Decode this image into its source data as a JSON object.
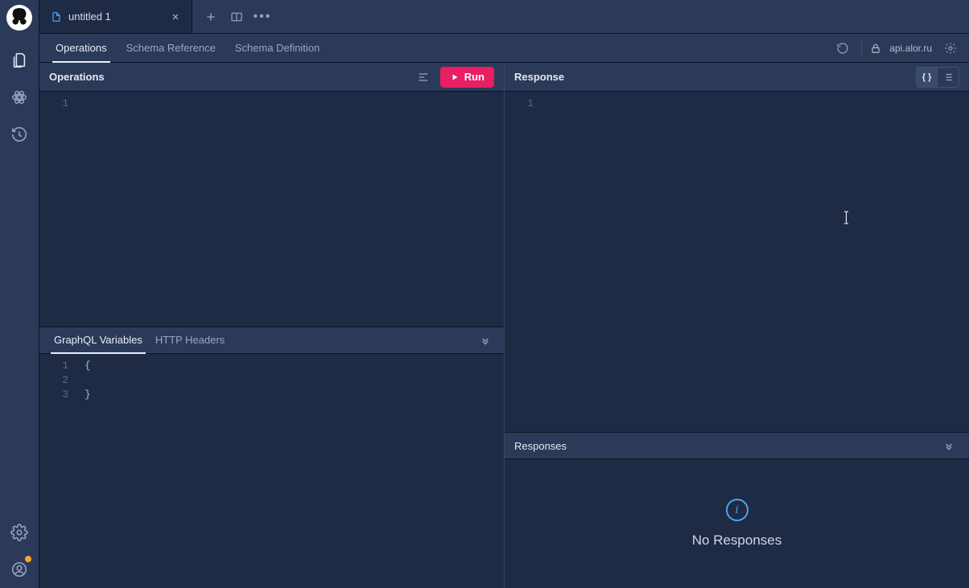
{
  "tab": {
    "label": "untitled 1"
  },
  "subTabs": {
    "operations": "Operations",
    "schemaRef": "Schema Reference",
    "schemaDef": "Schema Definition"
  },
  "endpoint": "api.alor.ru",
  "operations": {
    "title": "Operations",
    "run": "Run",
    "lines": [
      "1"
    ]
  },
  "response": {
    "title": "Response",
    "lines": [
      "1"
    ]
  },
  "variablesPanel": {
    "tabVariables": "GraphQL Variables",
    "tabHeaders": "HTTP Headers",
    "lineNumbers": [
      "1",
      "2",
      "3"
    ],
    "code": [
      "{",
      "",
      "}"
    ]
  },
  "responsesPanel": {
    "title": "Responses",
    "empty": "No Responses",
    "infoGlyph": "i"
  }
}
